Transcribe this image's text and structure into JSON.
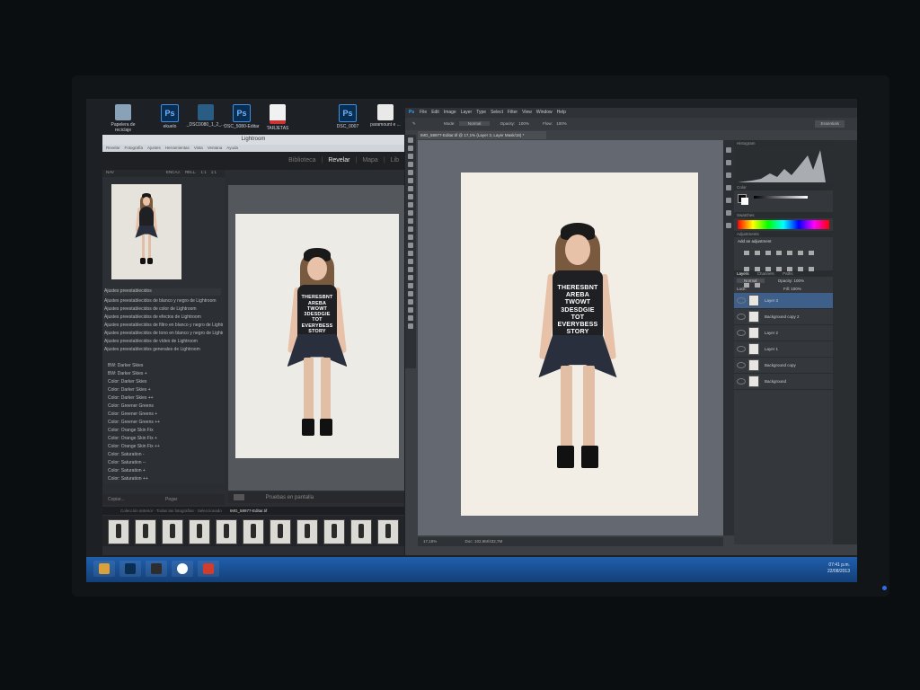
{
  "desktop": {
    "icons": [
      {
        "label": "Papelera de reciclaje",
        "kind": "trash"
      },
      {
        "label": "ekuelo",
        "kind": "ps"
      },
      {
        "label": "_DSC0080_1_2_...",
        "kind": "folder"
      },
      {
        "label": "DSC_5080-Editar",
        "kind": "ps"
      },
      {
        "label": "TARJETAS",
        "kind": "pdf"
      },
      {
        "label": "DSC_0007",
        "kind": "ps"
      },
      {
        "label": "paramount e ...",
        "kind": "doc"
      }
    ]
  },
  "lightroom": {
    "window_title": "Lightroom",
    "menu": [
      "Revelar",
      "Fotografía",
      "Ajustes",
      "Herramientas",
      "Vista",
      "Ventana",
      "Ayuda"
    ],
    "modules": [
      "Biblioteca",
      "Revelar",
      "Mapa",
      "Lib"
    ],
    "active_module": "Revelar",
    "navigator_labels": [
      "NAV",
      "ENCAJ.",
      "RELL.",
      "1:1",
      "1:1"
    ],
    "presets_header": "Ajustes preestablecidos",
    "presets": [
      "Ajustes preestablecidos de blanco y negro de Lightroom",
      "Ajustes preestablecidos de color de Lightroom",
      "Ajustes preestablecidos de efectos de Lightroom",
      "Ajustes preestablecidos de filtro en blanco y negro de Lightroom",
      "Ajustes preestablecidos de tono en blanco y negro de Lightroom",
      "Ajustes preestablecidos de vídeo de Lightroom",
      "Ajustes preestablecidos generales de Lightroom"
    ],
    "user_presets": [
      "BW: Darker Skies",
      "BW: Darker Skies +",
      "Color: Darker Skies",
      "Color: Darker Skies +",
      "Color: Darker Skies ++",
      "Color: Greener Greens",
      "Color: Greener Greens +",
      "Color: Greener Greens ++",
      "Color: Orange Skin Fix",
      "Color: Orange Skin Fix +",
      "Color: Orange Skin Fix ++",
      "Color: Saturation -",
      "Color: Saturation --",
      "Color: Saturation +",
      "Color: Saturation ++"
    ],
    "copy_button": "Copiar...",
    "paste_button": "Pegar",
    "proof_label": "Pruebas en pantalla",
    "filmstrip_path": "Colección anterior · Todas las fotografías · Seleccionado",
    "filmstrip_file": "IMG_58977-Editar.tif",
    "filmstrip_count": 11
  },
  "photoshop": {
    "logo": "Ps",
    "menu": [
      "File",
      "Edit",
      "Image",
      "Layer",
      "Type",
      "Select",
      "Filter",
      "View",
      "Window",
      "Help"
    ],
    "options": {
      "mode_label": "Mode:",
      "mode_value": "Normal",
      "opacity_label": "Opacity:",
      "opacity_value": "100%",
      "flow_label": "Flow:",
      "flow_value": "100%",
      "workspace": "Essentials"
    },
    "doc_tab": "IMG_58977-Editar.tif @ 17,1% (Layer 3, Layer Mask/16) *",
    "zoom": "17,18%",
    "doc_size": "Doc: 102,9M/432,7M",
    "histogram_label": "Histogram",
    "color_label": "Color",
    "swatches_label": "Swatches",
    "adjustments_label": "Adjustments",
    "add_adjustment": "Add an adjustment",
    "layers_tabs": [
      "Layers",
      "Channels",
      "Paths"
    ],
    "blend_mode": "Normal",
    "layer_opacity": "Opacity: 100%",
    "fill": "Fill: 100%",
    "lock_label": "Lock:",
    "layers": [
      {
        "name": "Layer 3",
        "selected": true
      },
      {
        "name": "Background copy 2",
        "selected": false
      },
      {
        "name": "Layer 2",
        "selected": false
      },
      {
        "name": "Layer 1",
        "selected": false
      },
      {
        "name": "Background copy",
        "selected": false
      },
      {
        "name": "Background",
        "selected": false
      }
    ]
  },
  "shirt_text": [
    "THERESBNT",
    "AREBA",
    "TWOWT",
    "3DESDGIE",
    "TOT",
    "EVERYBESS",
    "STORY"
  ],
  "taskbar": {
    "apps": [
      "Explorer",
      "Ps",
      "Lr",
      "Chrome",
      "App"
    ],
    "time": "07:41 p.m.",
    "date": "22/08/2013"
  },
  "colors": {
    "ps_accent": "#31a8ff",
    "taskbar": "#1f5fad",
    "selected_layer": "#3d5f8a"
  }
}
